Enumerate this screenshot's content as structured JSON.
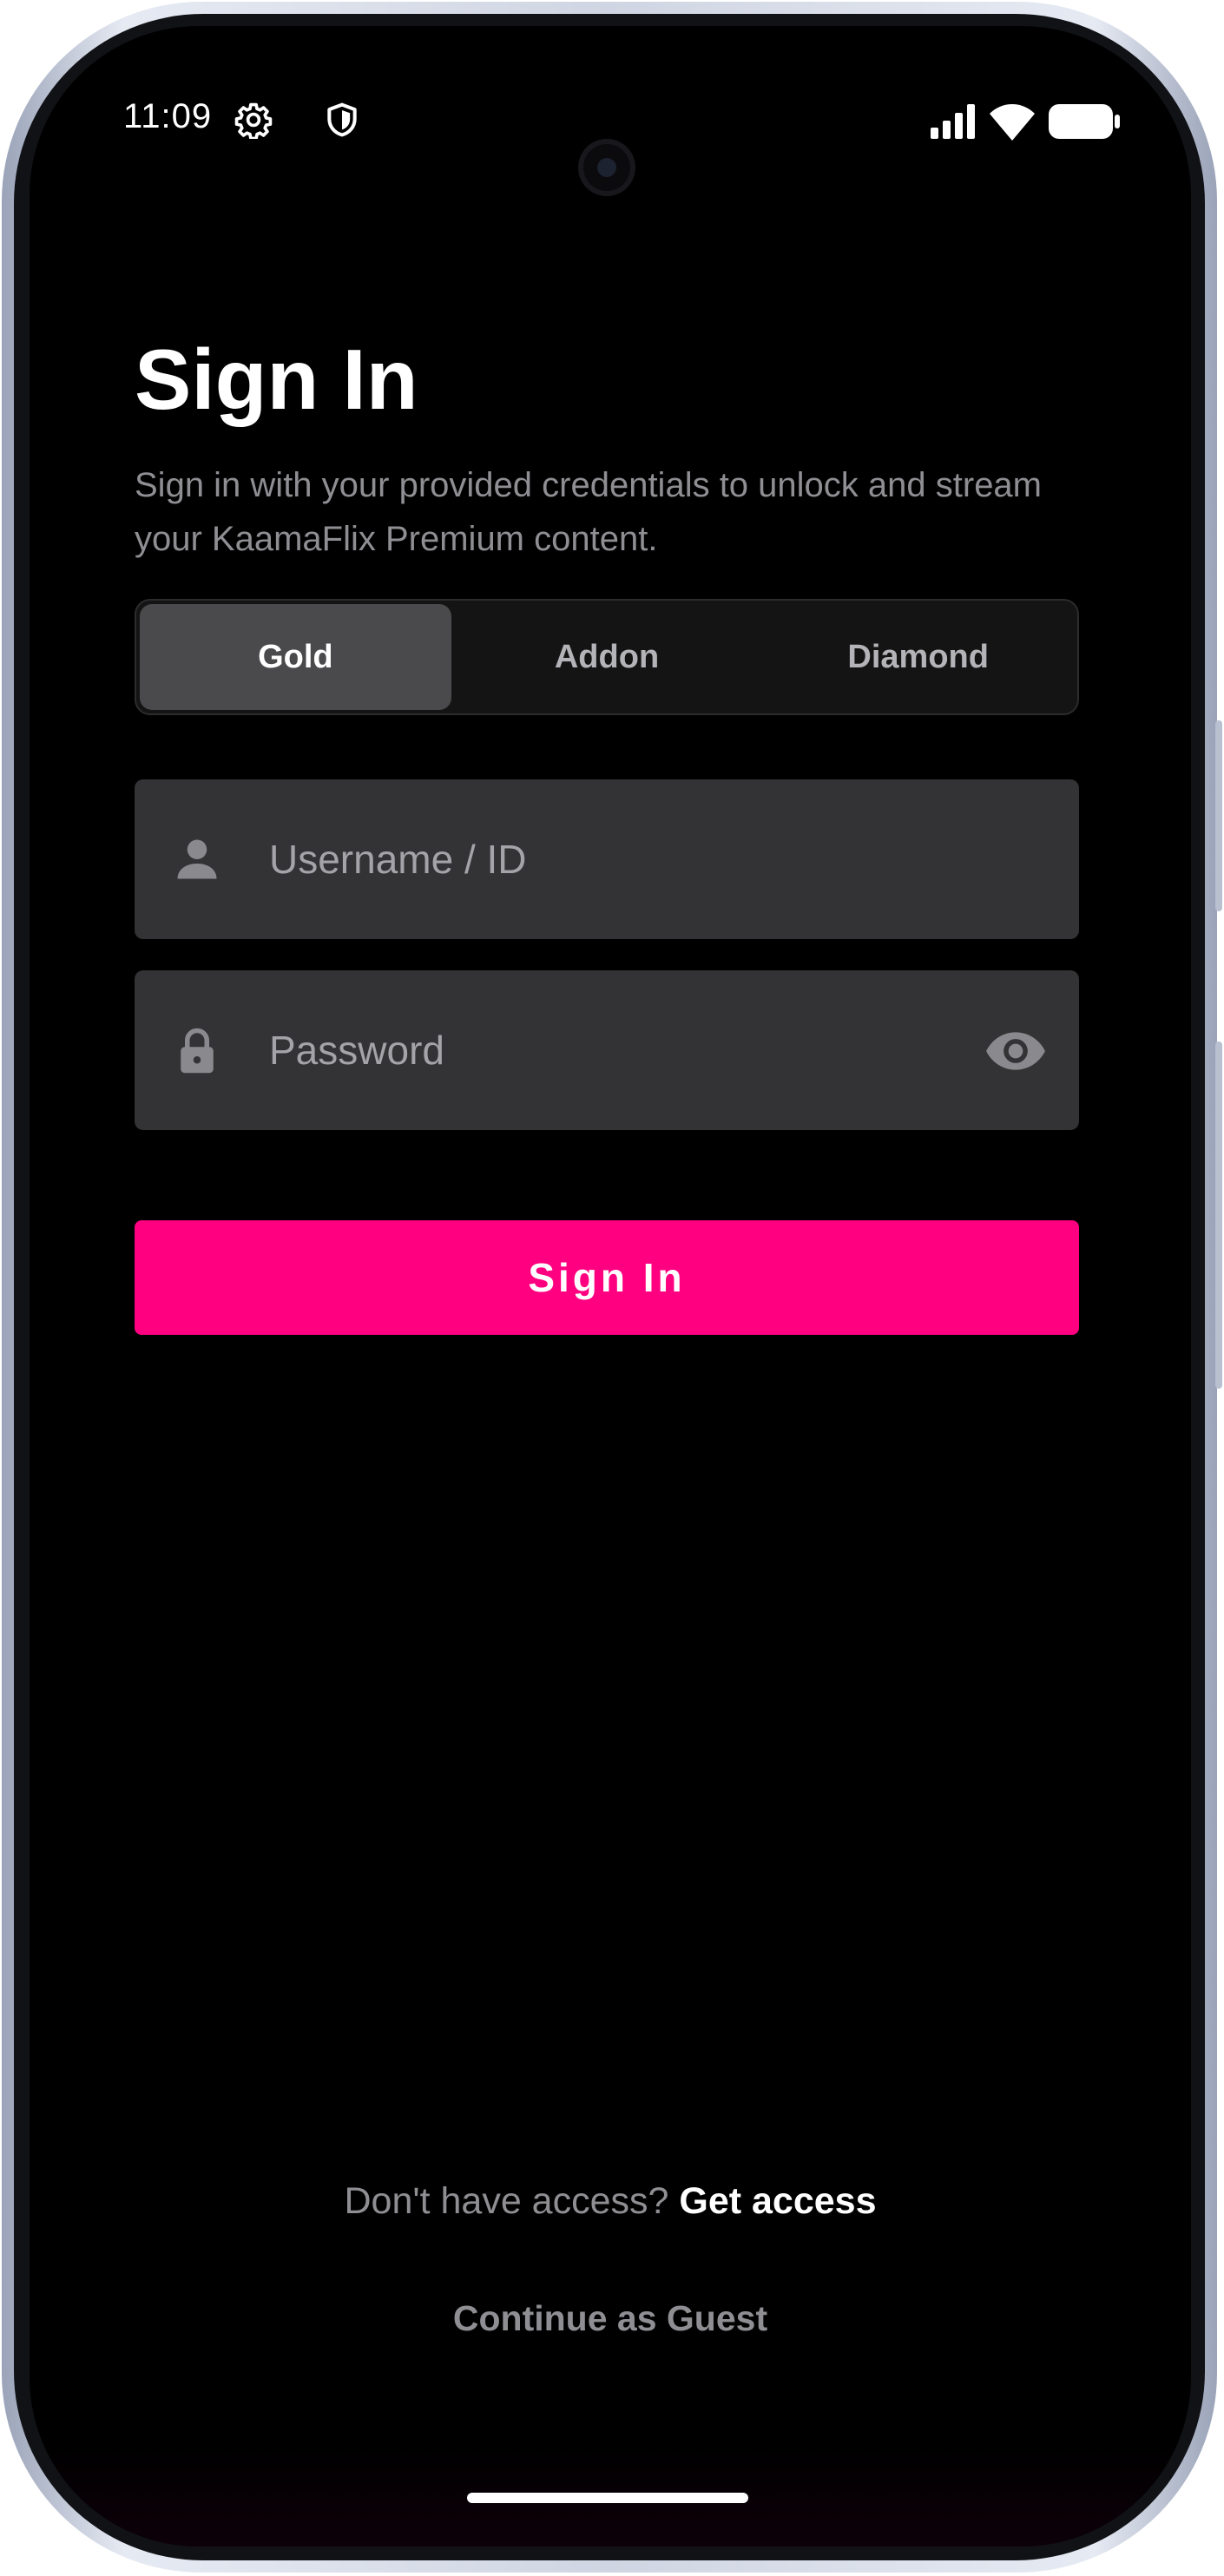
{
  "status_bar": {
    "time": "11:09",
    "left_icons": [
      "gear-icon",
      "shield-icon"
    ],
    "right_icons": [
      "signal-icon",
      "wifi-icon",
      "battery-icon"
    ]
  },
  "header": {
    "title": "Sign In",
    "subtitle": "Sign in with your provided credentials to unlock and stream your KaamaFlix Premium content."
  },
  "plan_tabs": {
    "items": [
      {
        "label": "Gold",
        "active": true
      },
      {
        "label": "Addon",
        "active": false
      },
      {
        "label": "Diamond",
        "active": false
      }
    ]
  },
  "form": {
    "username": {
      "placeholder": "Username / ID",
      "value": "",
      "icon": "person-icon"
    },
    "password": {
      "placeholder": "Password",
      "value": "",
      "icon": "lock-icon",
      "toggle_icon": "eye-icon"
    },
    "submit_label": "Sign In"
  },
  "footer": {
    "prompt": "Don't have access?",
    "link": "Get access",
    "guest": "Continue as Guest"
  },
  "colors": {
    "accent": "#ff0080",
    "background": "#000000",
    "field": "#333335",
    "muted_text": "#8e8e93"
  }
}
